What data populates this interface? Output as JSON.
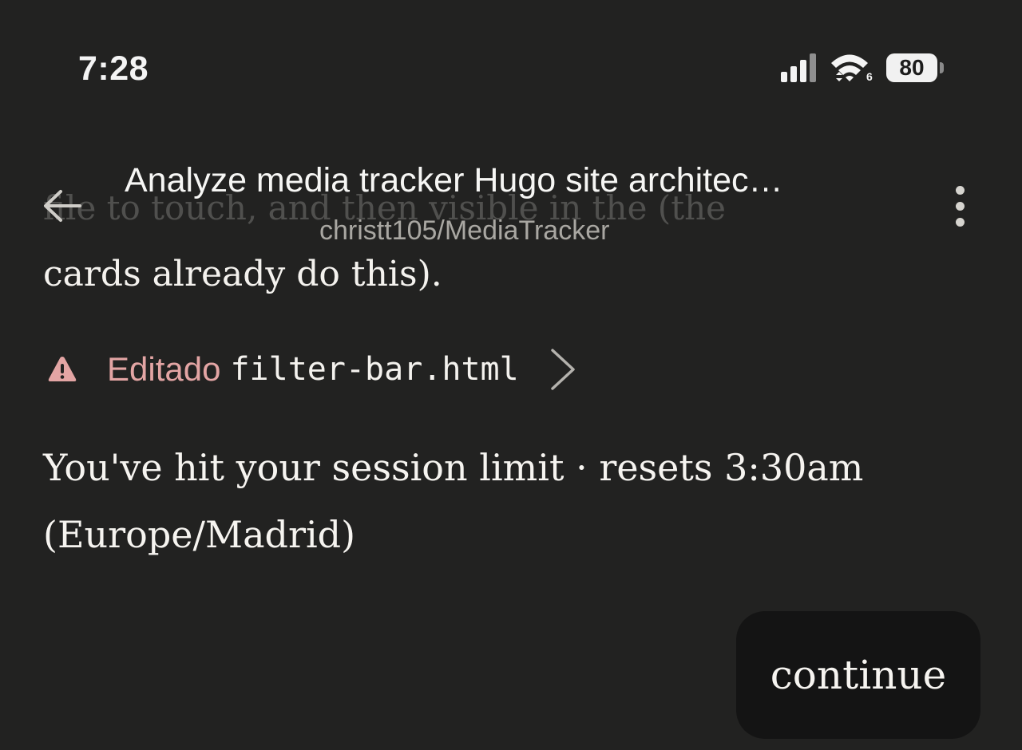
{
  "status_bar": {
    "time": "7:28",
    "wifi_badge": "6",
    "battery_level": "80"
  },
  "header": {
    "title": "Analyze media tracker Hugo site architec…",
    "subtitle": "christt105/MediaTracker",
    "back_icon": "arrow-left-icon",
    "menu_icon": "more-vertical-icon"
  },
  "conversation": {
    "faded_line": "file to touch, and then visible in the (the",
    "line": "cards already do this).",
    "tool_call": {
      "action": "Editado",
      "file": "filter-bar.html",
      "action_color": "#e3a5a4"
    },
    "limit_message": "You've hit your session limit · resets 3:30am (Europe/Madrid)"
  },
  "actions": {
    "continue_label": "continue"
  }
}
